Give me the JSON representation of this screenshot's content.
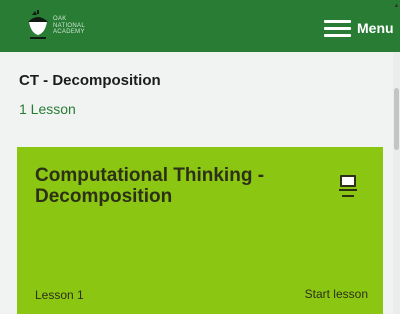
{
  "header": {
    "logo_lines": [
      "OAK",
      "NATIONAL",
      "ACADEMY"
    ],
    "menu_label": "Menu",
    "background": "#287c34"
  },
  "unit": {
    "title": "CT - Decomposition",
    "lesson_count": "1 Lesson"
  },
  "lesson_card": {
    "title": "Computational Thinking - Decomposition",
    "number_label": "Lesson 1",
    "action_label": "Start lesson",
    "icon": "laptop-icon",
    "background": "#8bc613"
  },
  "colors": {
    "accent": "#287c34",
    "card": "#8bc613",
    "page": "#f1f2f2"
  }
}
